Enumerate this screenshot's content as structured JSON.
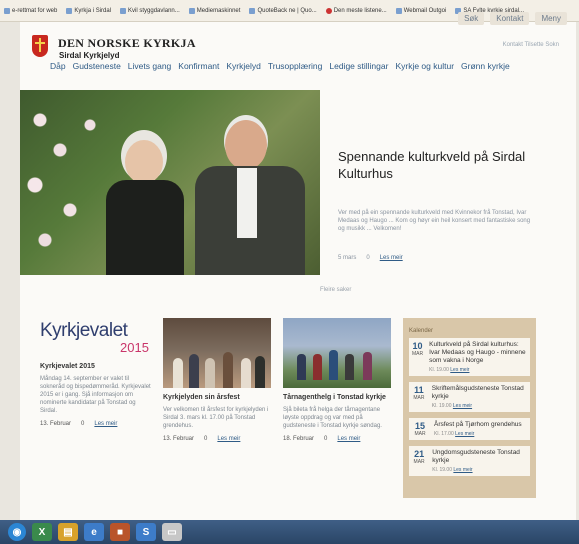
{
  "bookmarks": [
    {
      "label": "e-rettmat for web"
    },
    {
      "label": "Kyrkja i Sirdal"
    },
    {
      "label": "Kvil styggdavlann..."
    },
    {
      "label": "Mediemaskinnet"
    },
    {
      "label": "QuoteBack ne | Quo..."
    },
    {
      "label": "Den meste listene..."
    },
    {
      "label": "Webmail Outgoi"
    },
    {
      "label": "SA Fylte kyrkje sirdal..."
    }
  ],
  "toolbar": [
    "Søk",
    "Kontakt",
    "Meny"
  ],
  "header": {
    "org_title": "DEN NORSKE KYRKJA",
    "org_sub": "Sirdal Kyrkjelyd",
    "utility": "Kontakt   Tilsette   Sokn"
  },
  "nav": [
    "Dåp",
    "Gudsteneste",
    "Livets gang",
    "Konfirmant",
    "Kyrkjelyd",
    "Trusopplæring",
    "Ledige stillingar",
    "Kyrkje og kultur",
    "Grønn kyrkje"
  ],
  "hero": {
    "title": "Spennande kulturkveld på Sirdal Kulturhus",
    "body": "Ver med på ein spennande kulturkveld med Kvinnekor frå Tonstad, Ivar Medaas og Haugo ... Kom og høyr ein heil konsert med fantastiske song og musikk ... Velkomen!",
    "date": "5 mars",
    "comments": "0",
    "read_more": "Les meir",
    "pager": "Fleire saker"
  },
  "cards": [
    {
      "logo_word": "Kyrkjevalet",
      "logo_year": "2015",
      "title": "Kyrkjevalet 2015",
      "body": "Måndag 14. september er valet til sokneråd og bispedømmeråd. Kyrkjevalet 2015 er i gang. Sjå informasjon om nominerte kandidatar på Tonstad og Sirdal.",
      "date": "13. Februar",
      "comments": "0",
      "read_more": "Les meir"
    },
    {
      "title": "Kyrkjelyden sin årsfest",
      "body": "Ver velkomen til årsfest for kyrkjelyden i Sirdal 3. mars kl. 17.00 på Tonstad grendehus.",
      "date": "13. Februar",
      "comments": "0",
      "read_more": "Les meir"
    },
    {
      "title": "Tårnagenthelg i Tonstad kyrkje",
      "body": "Sjå bileta frå helga der tårnagentane løyste oppdrag og var med på gudsteneste i Tonstad kyrkje søndag.",
      "date": "18. Februar",
      "comments": "0",
      "read_more": "Les meir"
    }
  ],
  "events": {
    "heading": "Kalender",
    "items": [
      {
        "day": "10",
        "month": "MAR",
        "title": "Kulturkveld på Sirdal kulturhus: Ivar Medaas og Haugo - minnene som vakna i Norge",
        "time": "Kl. 19.00",
        "read_more": "Les meir"
      },
      {
        "day": "11",
        "month": "MAR",
        "title": "Skriftemålsgudsteneste Tonstad kyrkje",
        "time": "Kl. 19.00",
        "read_more": "Les meir"
      },
      {
        "day": "15",
        "month": "MAR",
        "title": "Årsfest på Tjørhom grendehus",
        "time": "Kl. 17.00",
        "read_more": "Les meir"
      },
      {
        "day": "21",
        "month": "MAR",
        "title": "Ungdomsgudsteneste Tonstad kyrkje",
        "time": "Kl. 19.00",
        "read_more": "Les meir"
      }
    ]
  },
  "colors": {
    "accent": "#2f5b86",
    "brand_red": "#c8281f",
    "sidebar": "#d9c7a9",
    "taskbar": "#2a4566"
  }
}
